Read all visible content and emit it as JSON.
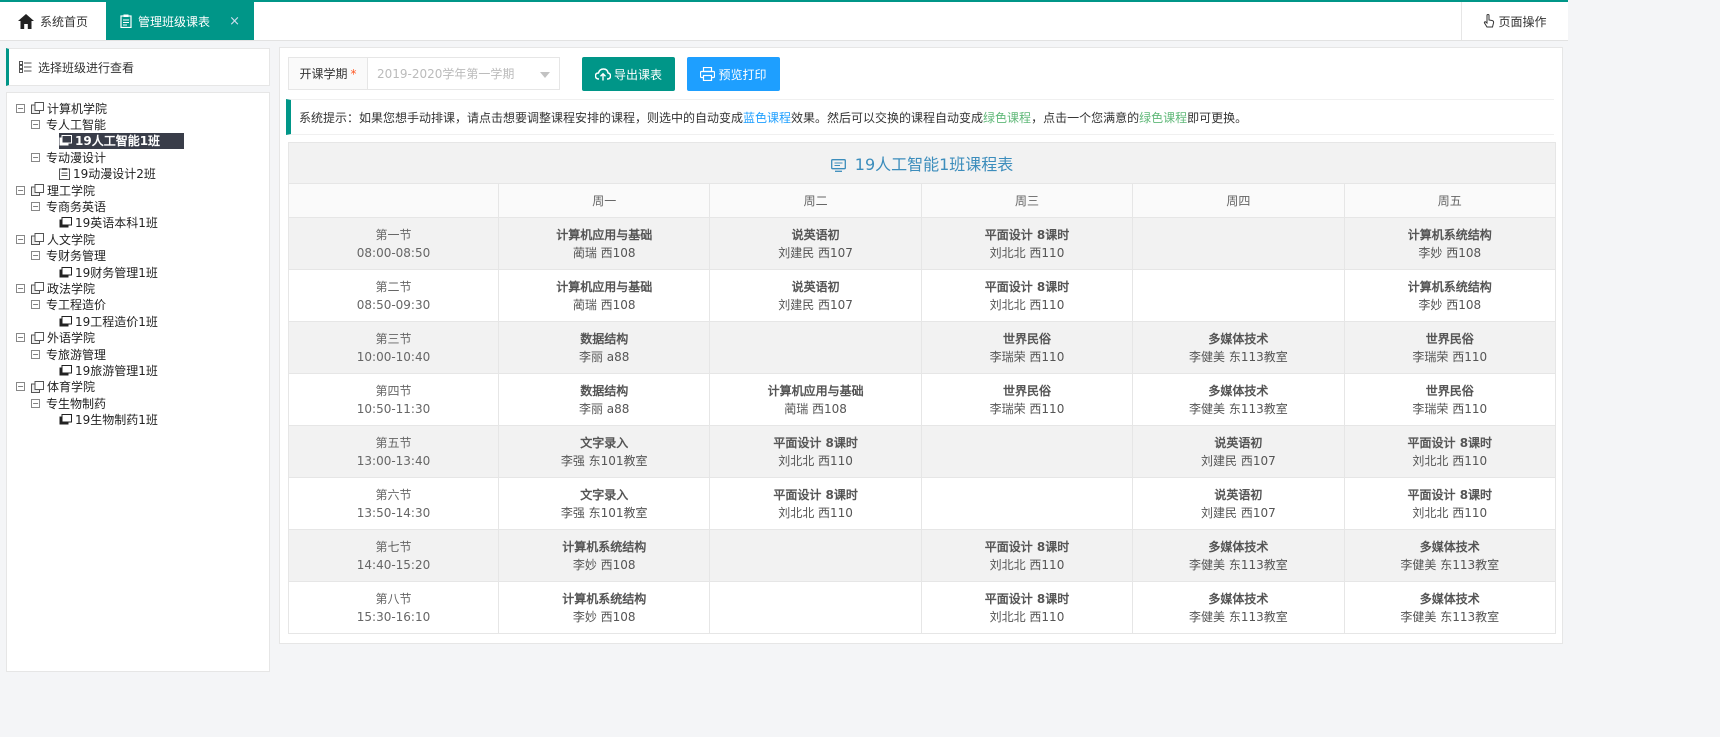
{
  "tabs": {
    "home": "系统首页",
    "active": "管理班级课表",
    "close": "×",
    "page_ops": "页面操作"
  },
  "sidebar": {
    "header": "选择班级进行查看",
    "tree": [
      {
        "label": "计算机学院",
        "level": 0,
        "type": "school",
        "toggle": "⊟"
      },
      {
        "label": "专人工智能",
        "level": 1,
        "type": "major",
        "toggle": "⊟"
      },
      {
        "label": "19人工智能1班",
        "level": 2,
        "type": "class",
        "selected": true
      },
      {
        "label": "专动漫设计",
        "level": 1,
        "type": "major",
        "toggle": "⊟"
      },
      {
        "label": "19动漫设计2班",
        "level": 2,
        "type": "class-doc"
      },
      {
        "label": "理工学院",
        "level": 0,
        "type": "school",
        "toggle": "⊟"
      },
      {
        "label": "专商务英语",
        "level": 1,
        "type": "major",
        "toggle": "⊟"
      },
      {
        "label": "19英语本科1班",
        "level": 2,
        "type": "class"
      },
      {
        "label": "人文学院",
        "level": 0,
        "type": "school",
        "toggle": "⊟"
      },
      {
        "label": "专财务管理",
        "level": 1,
        "type": "major",
        "toggle": "⊟"
      },
      {
        "label": "19财务管理1班",
        "level": 2,
        "type": "class"
      },
      {
        "label": "政法学院",
        "level": 0,
        "type": "school",
        "toggle": "⊟"
      },
      {
        "label": "专工程造价",
        "level": 1,
        "type": "major",
        "toggle": "⊟"
      },
      {
        "label": "19工程造价1班",
        "level": 2,
        "type": "class"
      },
      {
        "label": "外语学院",
        "level": 0,
        "type": "school",
        "toggle": "⊟"
      },
      {
        "label": "专旅游管理",
        "level": 1,
        "type": "major",
        "toggle": "⊟"
      },
      {
        "label": "19旅游管理1班",
        "level": 2,
        "type": "class"
      },
      {
        "label": "体育学院",
        "level": 0,
        "type": "school",
        "toggle": "⊟"
      },
      {
        "label": "专生物制药",
        "level": 1,
        "type": "major",
        "toggle": "⊟"
      },
      {
        "label": "19生物制药1班",
        "level": 2,
        "type": "class"
      }
    ]
  },
  "toolbar": {
    "semester_label": "开课学期",
    "required_mark": "*",
    "semester_value": "2019-2020学年第一学期",
    "export_label": "导出课表",
    "print_label": "预览打印"
  },
  "tip": {
    "prefix": "系统提示：如果您想手动排课，请点击想要调整课程安排的课程，则选中的自动变成",
    "blue": "蓝色课程",
    "mid1": "效果。然后可以交换的课程自动变成",
    "green1": "绿色课程",
    "mid2": "，点击一个您满意的",
    "green2": "绿色课程",
    "suffix": "即可更换。"
  },
  "timetable": {
    "title": "19人工智能1班课程表",
    "days": [
      "周一",
      "周二",
      "周三",
      "周四",
      "周五"
    ],
    "rows": [
      {
        "session": "第一节",
        "time": "08:00-08:50",
        "cells": [
          {
            "course": "计算机应用与基础",
            "info": "蔺瑞 西108"
          },
          {
            "course": "说英语初",
            "info": "刘建民 西107"
          },
          {
            "course": "平面设计 8课时",
            "info": "刘北北 西110"
          },
          {
            "course": "",
            "info": ""
          },
          {
            "course": "计算机系统结构",
            "info": "李妙 西108"
          }
        ]
      },
      {
        "session": "第二节",
        "time": "08:50-09:30",
        "cells": [
          {
            "course": "计算机应用与基础",
            "info": "蔺瑞 西108"
          },
          {
            "course": "说英语初",
            "info": "刘建民 西107"
          },
          {
            "course": "平面设计 8课时",
            "info": "刘北北 西110"
          },
          {
            "course": "",
            "info": ""
          },
          {
            "course": "计算机系统结构",
            "info": "李妙 西108"
          }
        ]
      },
      {
        "session": "第三节",
        "time": "10:00-10:40",
        "cells": [
          {
            "course": "数据结构",
            "info": "李丽 a88"
          },
          {
            "course": "",
            "info": ""
          },
          {
            "course": "世界民俗",
            "info": "李瑞荣 西110"
          },
          {
            "course": "多媒体技术",
            "info": "李健美 东113教室"
          },
          {
            "course": "世界民俗",
            "info": "李瑞荣 西110"
          }
        ]
      },
      {
        "session": "第四节",
        "time": "10:50-11:30",
        "cells": [
          {
            "course": "数据结构",
            "info": "李丽 a88"
          },
          {
            "course": "计算机应用与基础",
            "info": "蔺瑞 西108"
          },
          {
            "course": "世界民俗",
            "info": "李瑞荣 西110"
          },
          {
            "course": "多媒体技术",
            "info": "李健美 东113教室"
          },
          {
            "course": "世界民俗",
            "info": "李瑞荣 西110"
          }
        ]
      },
      {
        "session": "第五节",
        "time": "13:00-13:40",
        "cells": [
          {
            "course": "文字录入",
            "info": "李强 东101教室"
          },
          {
            "course": "平面设计 8课时",
            "info": "刘北北 西110"
          },
          {
            "course": "",
            "info": ""
          },
          {
            "course": "说英语初",
            "info": "刘建民 西107"
          },
          {
            "course": "平面设计 8课时",
            "info": "刘北北 西110"
          }
        ]
      },
      {
        "session": "第六节",
        "time": "13:50-14:30",
        "cells": [
          {
            "course": "文字录入",
            "info": "李强 东101教室"
          },
          {
            "course": "平面设计 8课时",
            "info": "刘北北 西110"
          },
          {
            "course": "",
            "info": ""
          },
          {
            "course": "说英语初",
            "info": "刘建民 西107"
          },
          {
            "course": "平面设计 8课时",
            "info": "刘北北 西110"
          }
        ]
      },
      {
        "session": "第七节",
        "time": "14:40-15:20",
        "cells": [
          {
            "course": "计算机系统结构",
            "info": "李妙 西108"
          },
          {
            "course": "",
            "info": ""
          },
          {
            "course": "平面设计 8课时",
            "info": "刘北北 西110"
          },
          {
            "course": "多媒体技术",
            "info": "李健美 东113教室"
          },
          {
            "course": "多媒体技术",
            "info": "李健美 东113教室"
          }
        ]
      },
      {
        "session": "第八节",
        "time": "15:30-16:10",
        "cells": [
          {
            "course": "计算机系统结构",
            "info": "李妙 西108"
          },
          {
            "course": "",
            "info": ""
          },
          {
            "course": "平面设计 8课时",
            "info": "刘北北 西110"
          },
          {
            "course": "多媒体技术",
            "info": "李健美 东113教室"
          },
          {
            "course": "多媒体技术",
            "info": "李健美 东113教室"
          }
        ]
      }
    ]
  },
  "colors": {
    "primary": "#009688",
    "blue_button": "#1e9fff",
    "title_blue": "#3c8dbc",
    "tip_blue": "#1e9fff",
    "tip_green": "#5fb878",
    "selected_node": "#393d49"
  },
  "icons": {
    "home": "home-icon",
    "tab": "clipboard-icon",
    "page_ops": "hand-pointer-icon",
    "sidebar_header": "list-icon",
    "export": "cloud-upload-icon",
    "print": "printer-icon",
    "title": "monitor-icon"
  }
}
